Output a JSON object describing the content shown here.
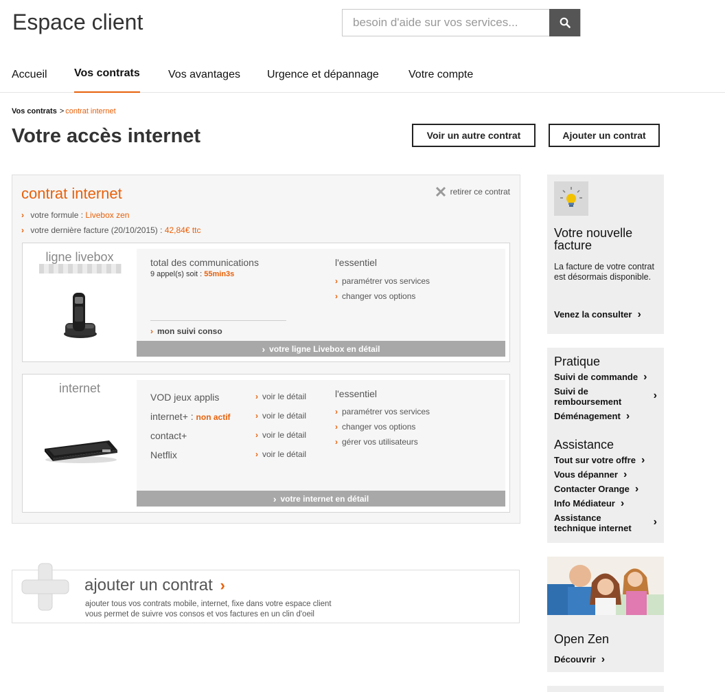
{
  "header": {
    "title": "Espace client",
    "search_placeholder": "besoin d'aide sur vos services..."
  },
  "nav": {
    "tabs": [
      {
        "label": "Accueil",
        "active": false
      },
      {
        "label": "Vos contrats",
        "active": true
      },
      {
        "label": "Vos avantages",
        "active": false
      },
      {
        "label": "Urgence et dépannage",
        "active": false
      },
      {
        "label": "Votre compte",
        "active": false
      }
    ]
  },
  "breadcrumb": {
    "root": "Vos contrats",
    "separator": ">",
    "current": "contrat internet"
  },
  "page": {
    "title": "Votre accès internet",
    "other_contract_label": "Voir un autre contrat",
    "add_contract_label": "Ajouter un contrat"
  },
  "contract": {
    "title": "contrat internet",
    "remove_label": "retirer ce contrat",
    "formula_label": "votre formule :",
    "formula_value": "Livebox zen",
    "last_bill_label": "votre dernière facture (20/10/2015) :",
    "last_bill_value": "42,84€ ttc",
    "livebox_line": {
      "title": "ligne livebox",
      "comms_title": "total des communications",
      "calls_text": "9 appel(s) soit :",
      "calls_duration": "55min3s",
      "tracking_label": "mon suivi conso",
      "essentials_title": "l'essentiel",
      "essentials": [
        "paramétrer vos services",
        "changer vos options"
      ],
      "detail_label": "votre ligne Livebox en détail"
    },
    "internet": {
      "title": "internet",
      "services": [
        {
          "name": "VOD jeux applis",
          "status": "",
          "link": "voir le détail"
        },
        {
          "name": "internet+ :",
          "status": "non actif",
          "link": "voir le détail"
        },
        {
          "name": "contact+",
          "status": "",
          "link": "voir le détail"
        },
        {
          "name": "Netflix",
          "status": "",
          "link": "voir le détail"
        }
      ],
      "essentials_title": "l'essentiel",
      "essentials": [
        "paramétrer vos services",
        "changer vos options",
        "gérer vos utilisateurs"
      ],
      "detail_label": "votre internet en détail"
    }
  },
  "add_contract": {
    "title": "ajouter un contrat",
    "desc_line1": "ajouter tous vos contrats mobile, internet, fixe dans votre espace client",
    "desc_line2": "vous permet de suivre vos consos et vos factures en un clin d'oeil"
  },
  "sidebar": {
    "bill": {
      "title": "Votre nouvelle facture",
      "text": "La facture de votre contrat est désormais disponible.",
      "link": "Venez la consulter"
    },
    "pratique": {
      "title": "Pratique",
      "links": [
        "Suivi de commande",
        "Suivi de remboursement",
        "Déménagement"
      ]
    },
    "assistance": {
      "title": "Assistance",
      "links": [
        "Tout sur votre offre",
        "Vous dépanner",
        "Contacter Orange",
        "Info Médiateur",
        "Assistance technique internet"
      ]
    },
    "promo": {
      "title": "Open Zen",
      "link": "Découvrir"
    }
  },
  "colors": {
    "accent": "#e8600a",
    "bar_gray": "#a8a8a8",
    "panel_bg": "#f6f6f6"
  }
}
